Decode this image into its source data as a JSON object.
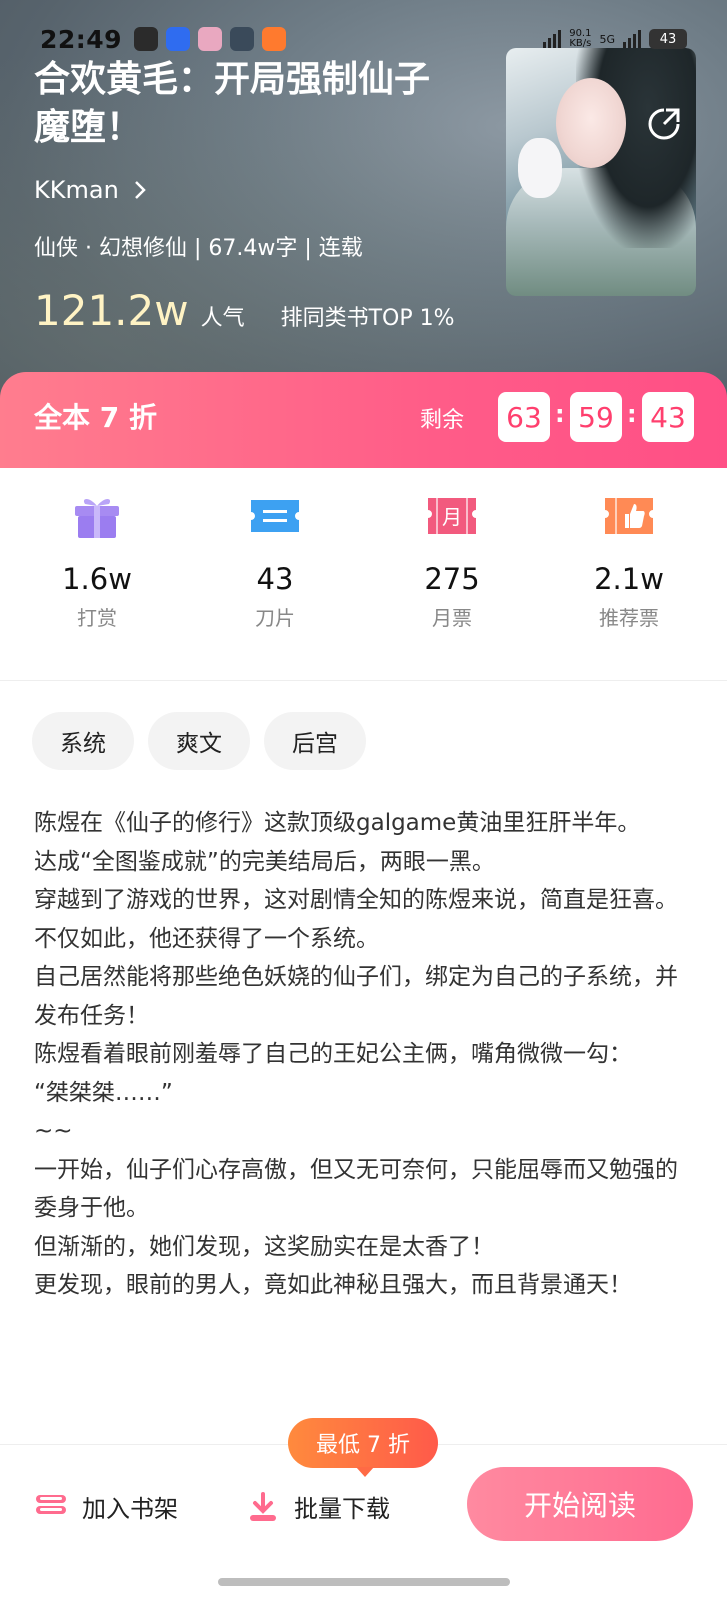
{
  "status": {
    "time": "22:49",
    "speed_top": "90.1",
    "speed_unit": "KB/s",
    "network": "5G",
    "battery": "43"
  },
  "book": {
    "title": "合欢黄毛：开局强制仙子魔堕！",
    "author": "KKman",
    "meta": "仙侠 · 幻想修仙 | 67.4w字 | 连载",
    "popularity": "121.2w",
    "popularity_label": "人气",
    "rank": "排同类书TOP 1%"
  },
  "promo": {
    "label": "全本 7 折",
    "remain_label": "剩余",
    "hours": "63",
    "minutes": "59",
    "seconds": "43",
    "sep": ":"
  },
  "stats": [
    {
      "value": "1.6w",
      "label": "打赏",
      "icon": "gift-icon"
    },
    {
      "value": "43",
      "label": "刀片",
      "icon": "ticket-icon"
    },
    {
      "value": "275",
      "label": "月票",
      "icon": "monthly-ticket-icon"
    },
    {
      "value": "2.1w",
      "label": "推荐票",
      "icon": "thumbs-up-ticket-icon"
    }
  ],
  "stat_icon_text": {
    "month": "月"
  },
  "tags": [
    "系统",
    "爽文",
    "后宫"
  ],
  "description": [
    "陈煜在《仙子的修行》这款顶级galgame黄油里狂肝半年。",
    "达成“全图鉴成就”的完美结局后，两眼一黑。",
    "穿越到了游戏的世界，这对剧情全知的陈煜来说，简直是狂喜。",
    "不仅如此，他还获得了一个系统。",
    "自己居然能将那些绝色妖娆的仙子们，绑定为自己的子系统，并发布任务！",
    "陈煜看着眼前刚羞辱了自己的王妃公主俩，嘴角微微一勾：",
    "“桀桀桀……”",
    "~~",
    "一开始，仙子们心存高傲，但又无可奈何，只能屈辱而又勉强的委身于他。",
    "但渐渐的，她们发现，这奖励实在是太香了！",
    "更发现，眼前的男人，竟如此神秘且强大，而且背景通天！"
  ],
  "bottom": {
    "shelf": "加入书架",
    "download": "批量下载",
    "read": "开始阅读",
    "bubble": "最低 7 折"
  },
  "colors": {
    "accent": "#ff5c88",
    "popularity": "#fff3c4",
    "bubble": "#ff6a45"
  }
}
